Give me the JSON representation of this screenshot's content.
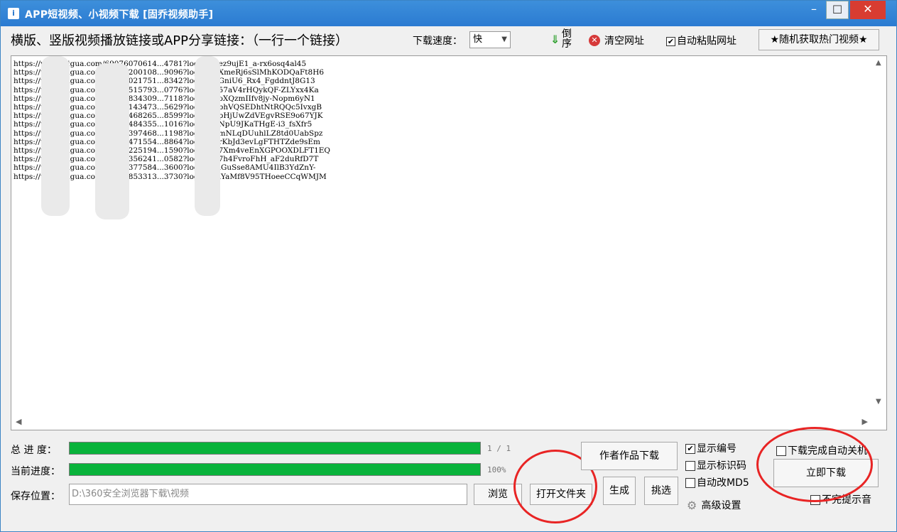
{
  "window": {
    "title": "APP短视频、小视频下载 [固乔视频助手]",
    "controls": {
      "minimize": "–",
      "maximize": "☐",
      "close": "✕"
    }
  },
  "toolbar": {
    "instruction": "横版、竖版视频播放链接或APP分享链接：（一行一个链接）",
    "speed_label": "下载速度：",
    "speed_value": "快",
    "reverse_label": "倒序",
    "clear_label": "清空网址",
    "auto_paste_label": "自动粘贴网址",
    "auto_paste_checked": true,
    "hot_button_label": "★随机获取热门视频★"
  },
  "links": [
    "https://www.ixigua.com/69076070614...4781?logTag=ez9ujE1_a-rx6osq4al45",
    "https://www.ixigua.com/69075200108...9096?logTag=XmeRj6sSlMhKODQaFt8H6",
    "https://www.ixigua.com/68444021751...8342?logTag=GniU6_Rx4_FgddntJ8G13",
    "https://www.ixigua.com/69082515793...0776?logTag=57aV4rHQykQF-ZLYxx4Ka",
    "https://www.ixigua.com/67815834309...7118?logTag=oXQzmIIfv8jy-Nopm6yN1",
    "https://www.ixigua.com/69075143473...5629?logTag=bhVQSEDhtNtRQQc5IvxgB",
    "https://www.ixigua.com/68696468265...8599?logTag=pHjUwZdVEgvRSE9o67YJK",
    "https://www.ixigua.com/69075484355...1016?logTag=NpU9JKaTHgE-i3_fsXfr5",
    "https://www.ixigua.com/68934397468...1198?logTag=mNLqDUuhlLZ8td0UabSpz",
    "https://www.ixigua.com/69079471554...8864?logTag=rKbJd3evLgFTHTZde9sEm",
    "https://www.ixigua.com/69086225194...1590?logTag=7Xm4veEnXGPOOXDLFT1EQ",
    "https://www.ixigua.com/69076356241...0582?logTag=7h4FvroFhH_aF2duRfD7T",
    "https://www.ixigua.com/68966377584...3600?logTag=lGuSse8AMU4IlB3YdZnY-",
    "https://www.ixigua.com/67897853313...3730?logTag=iYaMf8V95THoeeCCqWMJM"
  ],
  "progress": {
    "total_label": "总 进 度：",
    "total_value": 1.0,
    "total_text": "1 / 1",
    "current_label": "当前进度：",
    "current_value": 1.0,
    "current_text": "100%"
  },
  "save": {
    "label": "保存位置：",
    "path": "D:\\360安全浏览器下载\\视频",
    "browse_label": "浏览",
    "open_folder_label": "打开文件夹"
  },
  "actions": {
    "author_download_label": "作者作品下载",
    "generate_label": "生成",
    "pick_label": "挑选",
    "download_now_label": "立即下载"
  },
  "options": {
    "show_number_label": "显示编号",
    "show_number_checked": true,
    "show_id_label": "显示标识码",
    "show_id_checked": false,
    "auto_md5_label": "自动改MD5",
    "auto_md5_checked": false,
    "advanced_label": "高级设置",
    "auto_shutdown_label": "下载完成自动关机",
    "auto_shutdown_checked": false,
    "no_sound_label": "不完提示音",
    "no_sound_checked": false
  },
  "colors": {
    "title_bar": "#2b7bd1",
    "progress_fill": "#09b33b",
    "highlight_circle": "#e82424"
  }
}
